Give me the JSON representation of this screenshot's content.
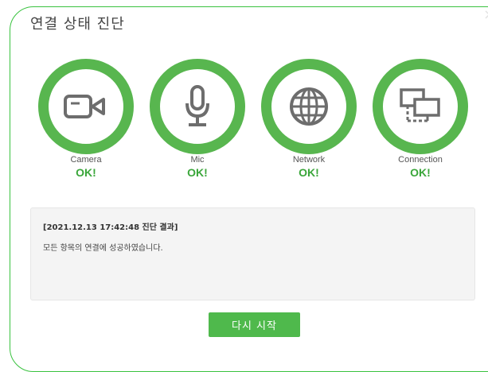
{
  "dialog": {
    "title": "연결 상태 진단",
    "close_icon": "close-icon"
  },
  "checks": [
    {
      "icon": "camera-icon",
      "label": "Camera",
      "status": "OK!"
    },
    {
      "icon": "microphone-icon",
      "label": "Mic",
      "status": "OK!"
    },
    {
      "icon": "globe-icon",
      "label": "Network",
      "status": "OK!"
    },
    {
      "icon": "screens-connection-icon",
      "label": "Connection",
      "status": "OK!"
    }
  ],
  "result": {
    "title": "[2021.12.13 17:42:48 진단 결과]",
    "message": "모든 항목의 연결에 성공하였습니다."
  },
  "actions": {
    "retry_label": "다시 시작"
  },
  "colors": {
    "accent": "#4fb94c",
    "ring": "#58b64f",
    "status_text": "#3aa63a",
    "dialog_border": "#39c23f",
    "icon": "#6d6d6d"
  }
}
